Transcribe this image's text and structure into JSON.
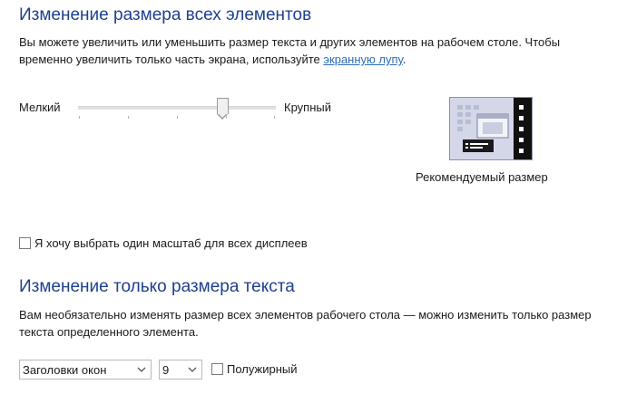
{
  "section1": {
    "title": "Изменение размера всех элементов",
    "desc_prefix": "Вы можете увеличить или уменьшить размер текста и других элементов на рабочем столе. Чтобы временно увеличить только часть экрана, используйте ",
    "desc_link": "экранную лупу",
    "desc_suffix": "."
  },
  "slider": {
    "min_label": "Мелкий",
    "max_label": "Крупный",
    "value_fraction": 0.73
  },
  "preview": {
    "caption": "Рекомендуемый размер"
  },
  "checkbox_all_displays": {
    "label": "Я хочу выбрать один масштаб для всех дисплеев",
    "checked": false
  },
  "section2": {
    "title": "Изменение только размера текста",
    "desc": "Вам необязательно изменять размер всех элементов рабочего стола — можно изменить только размер текста определенного элемента."
  },
  "element_select": {
    "value": "Заголовки окон"
  },
  "size_select": {
    "value": "9"
  },
  "bold_checkbox": {
    "label": "Полужирный",
    "checked": false
  },
  "colors": {
    "heading": "#1e3f8f",
    "link": "#2b6cb7"
  }
}
